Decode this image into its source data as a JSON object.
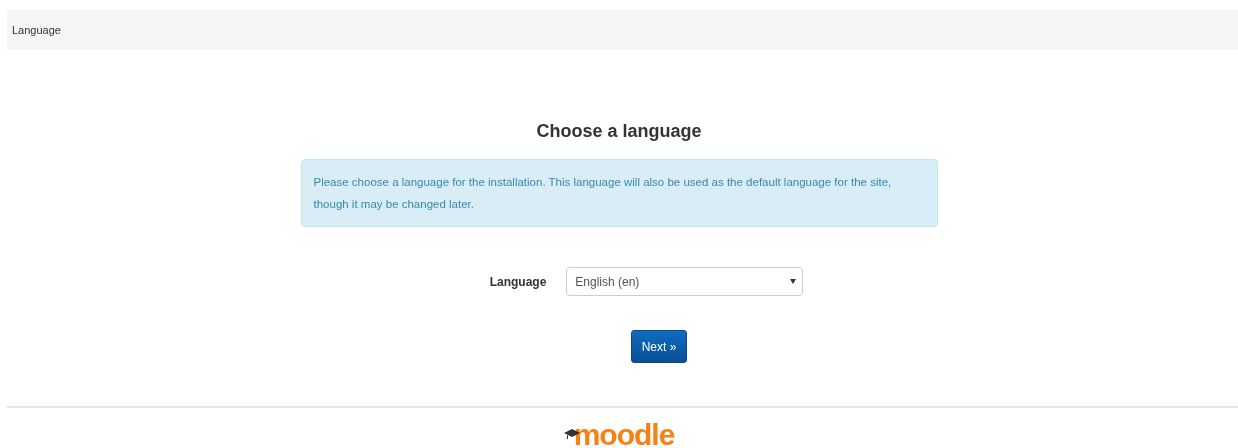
{
  "header": {
    "title": "Language"
  },
  "heading": "Choose a language",
  "notice": "Please choose a language for the installation. This language will also be used as the default language for the site, though it may be changed later.",
  "language_field": {
    "label": "Language",
    "value": "English (en)"
  },
  "next_button": "Next »",
  "footer": {
    "logo_text": "moodle"
  }
}
